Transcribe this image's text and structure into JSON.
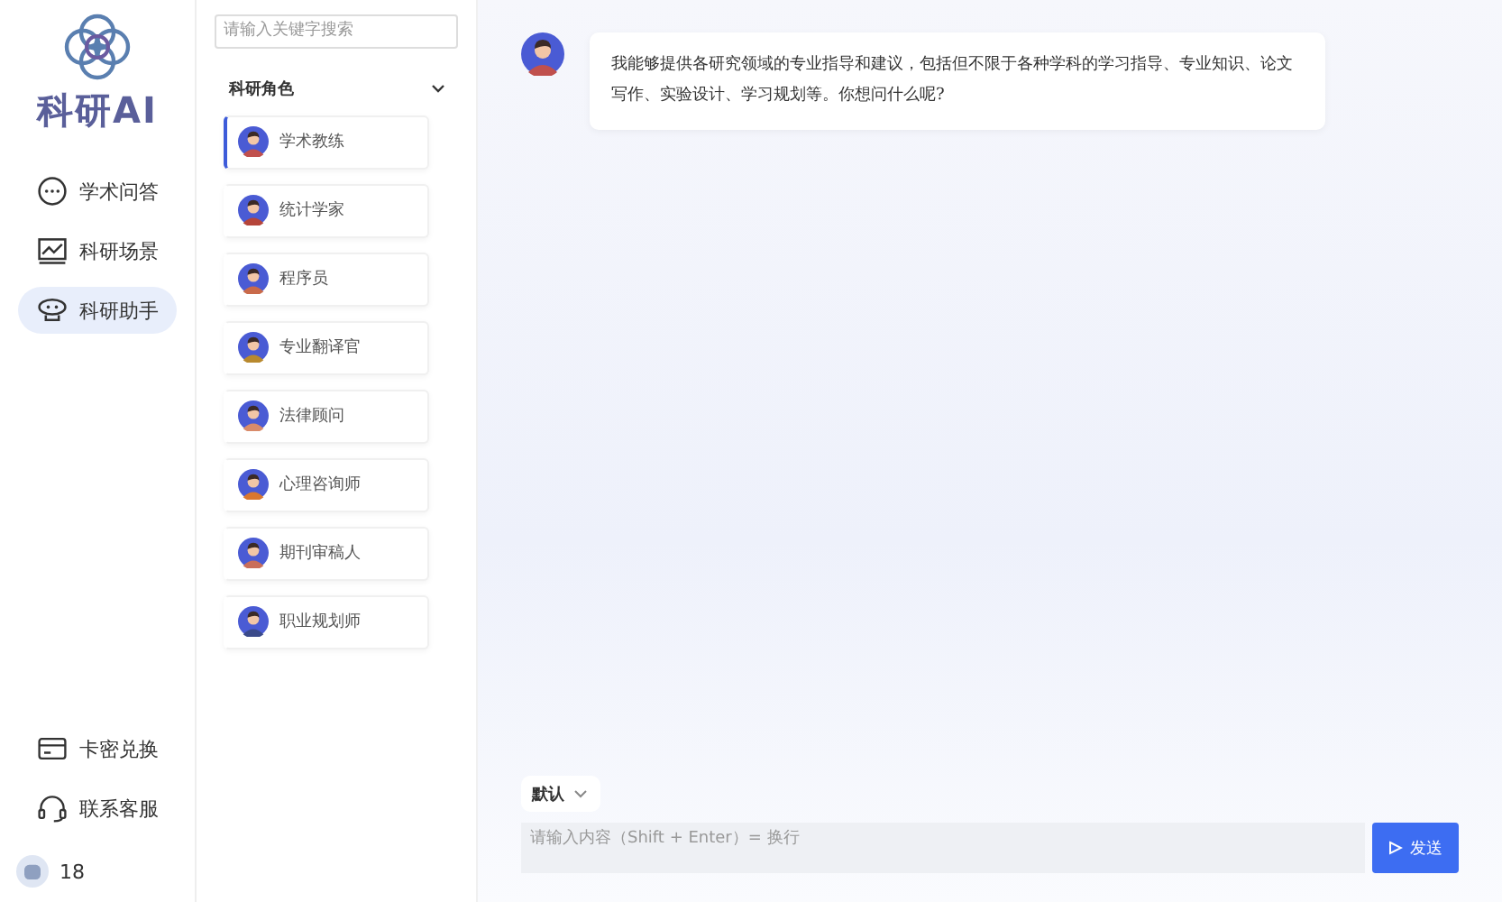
{
  "brand": {
    "name": "科研AI"
  },
  "nav": [
    {
      "kind": "chat",
      "label": "学术问答",
      "selected": false
    },
    {
      "kind": "chart",
      "label": "科研场景",
      "selected": false
    },
    {
      "kind": "robot",
      "label": "科研助手",
      "selected": true
    }
  ],
  "nav_bottom": [
    {
      "kind": "card",
      "label": "卡密兑换"
    },
    {
      "kind": "headset",
      "label": "联系客服"
    }
  ],
  "user": {
    "name": "18"
  },
  "search": {
    "placeholder": "请输入关键字搜索"
  },
  "roles_group": {
    "title": "科研角色",
    "expanded": true
  },
  "roles": [
    {
      "label": "学术教练",
      "selected": true,
      "color": "#c0504d"
    },
    {
      "label": "统计学家",
      "selected": false,
      "color": "#b5453a"
    },
    {
      "label": "程序员",
      "selected": false,
      "color": "#c96a4a"
    },
    {
      "label": "专业翻译官",
      "selected": false,
      "color": "#b8892e"
    },
    {
      "label": "法律顾问",
      "selected": false,
      "color": "#d98b6a"
    },
    {
      "label": "心理咨询师",
      "selected": false,
      "color": "#d9772f"
    },
    {
      "label": "期刊审稿人",
      "selected": false,
      "color": "#c96e5a"
    },
    {
      "label": "职业规划师",
      "selected": false,
      "color": "#3a4a8a"
    }
  ],
  "message": {
    "text": "我能够提供各研究领域的专业指导和建议，包括但不限于各种学科的学习指导、专业知识、论文写作、实验设计、学习规划等。你想问什么呢?"
  },
  "model_select": {
    "value": "默认"
  },
  "composer": {
    "placeholder": "请输入内容（Shift + Enter）= 换行"
  },
  "send_button": {
    "label": "发送"
  }
}
